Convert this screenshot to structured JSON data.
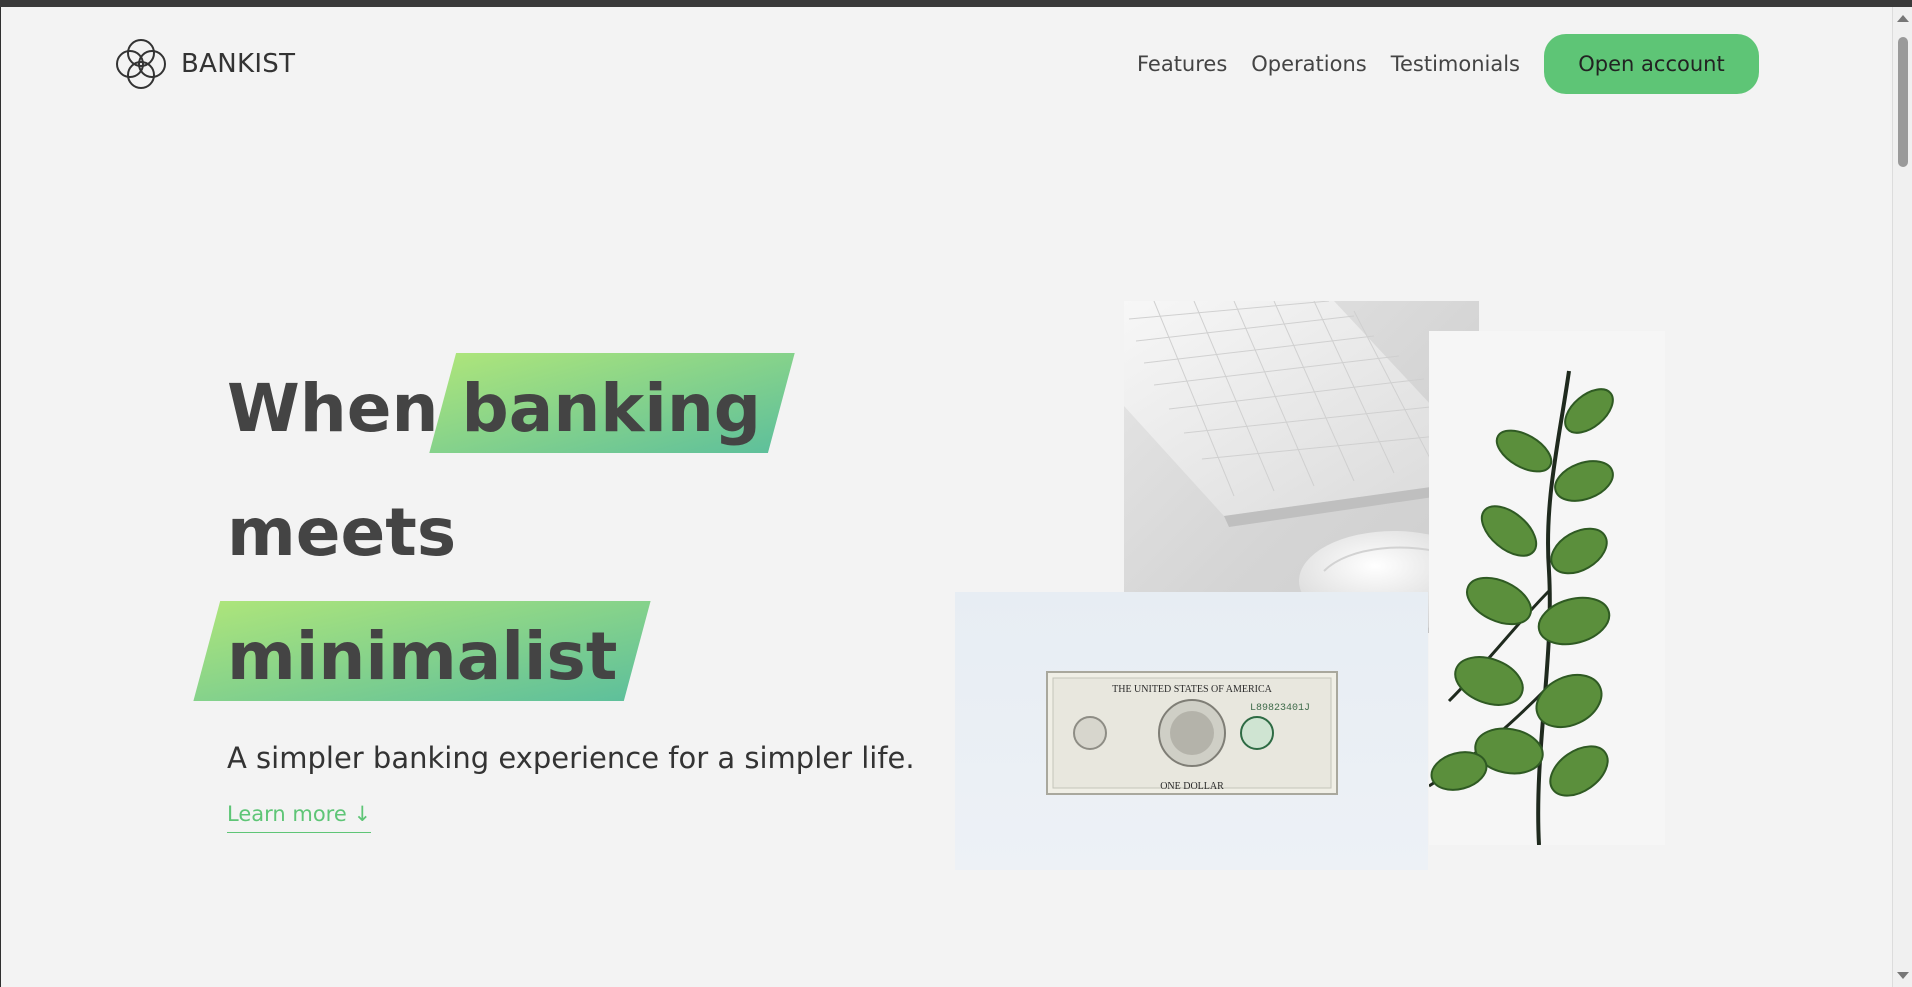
{
  "nav": {
    "brand": "BANKIST",
    "links": [
      "Features",
      "Operations",
      "Testimonials"
    ],
    "cta": "Open account"
  },
  "hero": {
    "title_line1_word1": "When",
    "title_line1_highlight": "banking",
    "title_line2": "meets",
    "title_line3_highlight": "minimalist",
    "subtitle": "A simpler banking experience for a simpler life.",
    "learn_more": "Learn more ↓"
  },
  "images": {
    "keyboard_alt": "Keyboard and mouse",
    "plant_alt": "Green plant branch",
    "dollar_alt": "One dollar bill",
    "dollar_text_top": "THE UNITED STATES OF AMERICA",
    "dollar_text_bottom": "ONE DOLLAR",
    "dollar_serial": "L89823401J"
  },
  "colors": {
    "accent": "#5ec576",
    "gradient_start": "#9be15d",
    "gradient_end": "#39b385",
    "text": "#444444",
    "page_bg": "#f3f3f3"
  },
  "icons": {
    "logo": "bankist-logo-icon",
    "scroll_up": "scroll-up-icon",
    "scroll_down": "scroll-down-icon"
  }
}
